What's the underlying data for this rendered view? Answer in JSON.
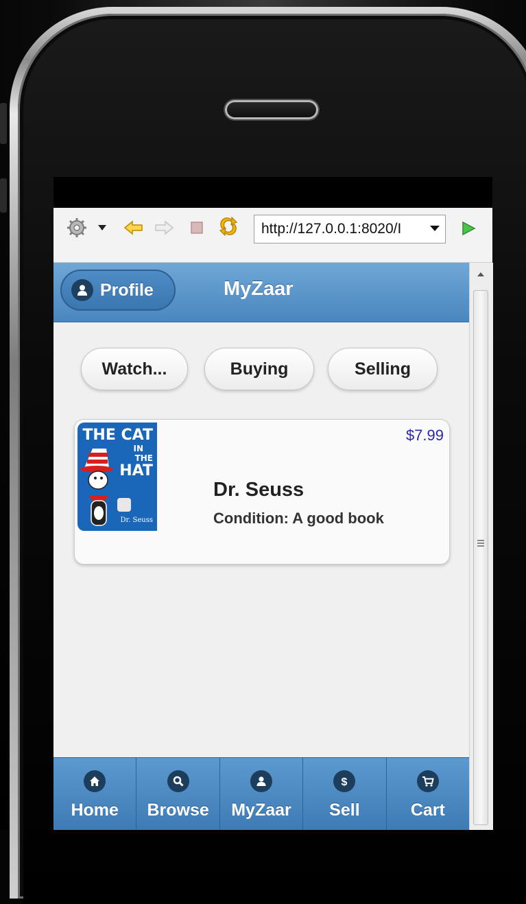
{
  "browser": {
    "url": "http://127.0.0.1:8020/I",
    "icons": [
      "gear-icon",
      "dropdown-arrow-icon",
      "back-arrow-icon",
      "forward-arrow-icon",
      "stop-icon",
      "refresh-icon",
      "go-icon"
    ]
  },
  "header": {
    "profile_label": "Profile",
    "title": "MyZaar"
  },
  "segments": [
    {
      "label": "Watch..."
    },
    {
      "label": "Buying"
    },
    {
      "label": "Selling"
    }
  ],
  "item": {
    "price": "$7.99",
    "title": "Dr. Seuss",
    "condition": "Condition: A good book",
    "cover": {
      "line1": "THE CAT",
      "line2": "IN",
      "line3": "THE",
      "line4": "HAT",
      "author": "Dr. Seuss"
    }
  },
  "tabbar": [
    {
      "label": "Home",
      "icon": "home-icon"
    },
    {
      "label": "Browse",
      "icon": "search-icon"
    },
    {
      "label": "MyZaar",
      "icon": "user-icon"
    },
    {
      "label": "Sell",
      "icon": "dollar-icon"
    },
    {
      "label": "Cart",
      "icon": "cart-icon"
    }
  ],
  "colors": {
    "header_blue": "#4a86bf",
    "price_color": "#2a2aa8",
    "go_green": "#3aa83a"
  }
}
